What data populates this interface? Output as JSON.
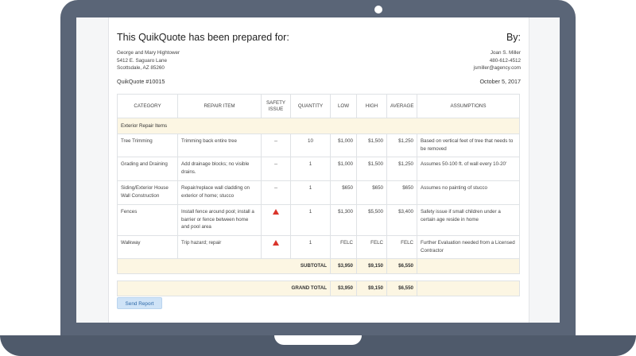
{
  "header": {
    "prepared_for": "This QuikQuote has been prepared for:",
    "by": "By:"
  },
  "client": {
    "name": "George and Mary Hightower",
    "street": "5412 E. Saguaro Lane",
    "city": "Scottsdale, AZ 85260"
  },
  "agent": {
    "name": "Joan S. Miller",
    "phone": "480-612-4512",
    "email": "jsmiller@agency.com"
  },
  "quote": {
    "number": "QuikQuote #10015",
    "date": "October 5, 2017"
  },
  "table": {
    "headers": {
      "category": "CATEGORY",
      "repair_item": "REPAIR ITEM",
      "safety_line1": "SAFETY",
      "safety_line2": "ISSUE",
      "quantity": "QUANTITY",
      "low": "LOW",
      "high": "HIGH",
      "average": "AVERAGE",
      "assumptions": "ASSUMPTIONS"
    },
    "group": "Exterior Repair Items",
    "rows": [
      {
        "category": "Tree Trimming",
        "repair_item": "Trimming back entire tree",
        "safety": "--",
        "quantity": "10",
        "low": "$1,000",
        "high": "$1,500",
        "average": "$1,250",
        "assumptions": "Based on vertical feet of tree that needs to be removed"
      },
      {
        "category": "Grading and Draining",
        "repair_item": "Add drainage blocks; no visible drains.",
        "safety": "--",
        "quantity": "1",
        "low": "$1,000",
        "high": "$1,500",
        "average": "$1,250",
        "assumptions": "Assumes 50-100 ft. of wall every 10-20'"
      },
      {
        "category": "Siding/Exterior House Wall Construction",
        "repair_item": "Repair/replace wall cladding on exterior of home; stucco",
        "safety": "--",
        "quantity": "1",
        "low": "$650",
        "high": "$650",
        "average": "$650",
        "assumptions": "Assumes no painting of stucco"
      },
      {
        "category": "Fences",
        "repair_item": "Install fence around pool; install a barrier or fence between home and pool area",
        "safety": "warning",
        "quantity": "1",
        "low": "$1,300",
        "high": "$5,500",
        "average": "$3,400",
        "assumptions": "Safety issue if small children under a certain age reside in home"
      },
      {
        "category": "Walkway",
        "repair_item": "Trip hazard; repair",
        "safety": "warning",
        "quantity": "1",
        "low": "FELC",
        "high": "FELC",
        "average": "FELC",
        "assumptions": "Further Evaluation needed from a Licensed Contractor"
      }
    ],
    "subtotal": {
      "label": "SUBTOTAL",
      "low": "$3,950",
      "high": "$9,150",
      "average": "$6,550"
    },
    "grand_total": {
      "label": "GRAND TOTAL",
      "low": "$3,950",
      "high": "$9,150",
      "average": "$6,550"
    }
  },
  "send_button": "Send Report",
  "colors": {
    "laptop_frame": "#5a6577",
    "highlight_row": "#fcf6e3",
    "warning": "#d9342b",
    "button_bg": "#cfe3f7",
    "button_text": "#2f6aa8"
  }
}
